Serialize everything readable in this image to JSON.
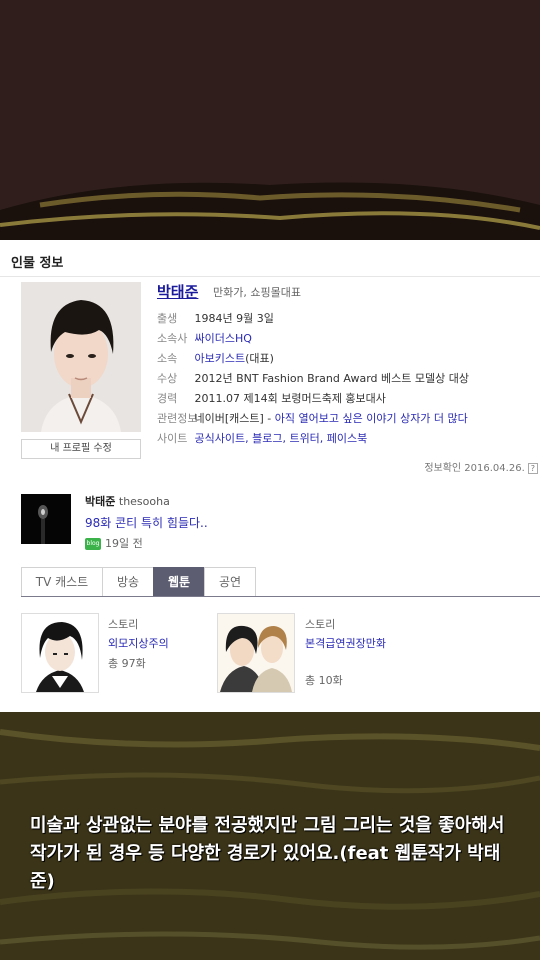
{
  "section_title": "인물 정보",
  "profile": {
    "name": "박태준",
    "role": "만화가, 쇼핑몰대표",
    "edit_button": "내 프로필 수정",
    "rows": [
      {
        "label": "출생",
        "value": "1984년 9월 3일",
        "link": ""
      },
      {
        "label": "소속사",
        "value": "",
        "link": "싸이더스HQ"
      },
      {
        "label": "소속",
        "value": "(대표)",
        "link": "아보키스트"
      },
      {
        "label": "수상",
        "value": "2012년 BNT Fashion Brand Award 베스트 모델상 대상",
        "link": ""
      },
      {
        "label": "경력",
        "value": "2011.07 제14회 보령머드축제 홍보대사",
        "link": ""
      },
      {
        "label": "관련정보",
        "value": "네이버[캐스트] - ",
        "link": "아직 열어보고 싶은 이야기 상자가 더 많다"
      },
      {
        "label": "사이트",
        "value": "",
        "link": "공식사이트, 블로그, 트위터, 페이스북"
      }
    ],
    "checked_date": "정보확인 2016.04.26.",
    "help_icon": "?"
  },
  "blog": {
    "author": "박태준",
    "blog_id": "thesooha",
    "post_title": "98화 콘티 특히 힘들다..",
    "badge": "blog",
    "time": "19일 전"
  },
  "tabs": [
    {
      "label": "TV 캐스트",
      "active": false
    },
    {
      "label": "방송",
      "active": false
    },
    {
      "label": "웹툰",
      "active": true
    },
    {
      "label": "공연",
      "active": false
    }
  ],
  "webtoons": [
    {
      "category": "스토리",
      "title": "외모지상주의",
      "count": "총 97화"
    },
    {
      "category": "스토리",
      "title": "본격급연권장만화",
      "count": "총 10화"
    }
  ],
  "caption": "미술과 상관없는 분야를 전공했지만 그림 그리는 것을 좋아해서 작가가 된 경우 등 다양한 경로가 있어요.(feat 웹툰작가 박태준)"
}
